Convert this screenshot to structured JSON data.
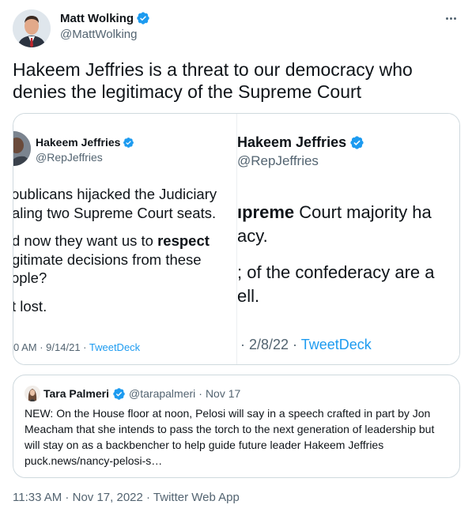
{
  "author": {
    "name": "Matt Wolking",
    "handle": "@MattWolking"
  },
  "tweet": {
    "text_line1": "Hakeem Jeffries is a threat to our democracy who",
    "text_line2": "denies the legitimacy of the Supreme Court"
  },
  "media": {
    "left": {
      "name": "Hakeem Jeffries",
      "handle": "@RepJeffries",
      "line1": "ɔublicans hijacked the Judiciary",
      "line2": "aling two Supreme Court seats.",
      "line3_pre": "d now they want us to ",
      "line3_bold": "respect",
      "line4": "gitimate decisions from these",
      "line5": "ɔple?",
      "line6": "t lost.",
      "meta_pre": "0 AM · 9/14/21 · ",
      "meta_link": "TweetDeck"
    },
    "right": {
      "name": "Hakeem Jeffries",
      "handle": "@RepJeffries",
      "line1_bold": "ıpreme",
      "line1_rest": " Court majority ha",
      "line2": "acy.",
      "line3": "; of the confederacy are a",
      "line4": "ell.",
      "meta_pre": "· 2/8/22 · ",
      "meta_link": "TweetDeck"
    }
  },
  "quote": {
    "name": "Tara Palmeri",
    "handle": "@tarapalmeri",
    "separator": "·",
    "date": "Nov 17",
    "text": "NEW: On the House floor at noon, Pelosi will say in a speech crafted in part by Jon Meacham that she intends to pass the torch to the next generation of leadership but will stay on as a backbencher to help guide future leader Hakeem Jeffries puck.news/nancy-pelosi-s…"
  },
  "footer": {
    "time": "11:33 AM",
    "date": "Nov 17, 2022",
    "source": "Twitter Web App",
    "sep": " · "
  },
  "colors": {
    "verified": "#1d9bf0",
    "link": "#1d9bf0",
    "secondary_text": "#536471",
    "border": "#cfd9de"
  }
}
